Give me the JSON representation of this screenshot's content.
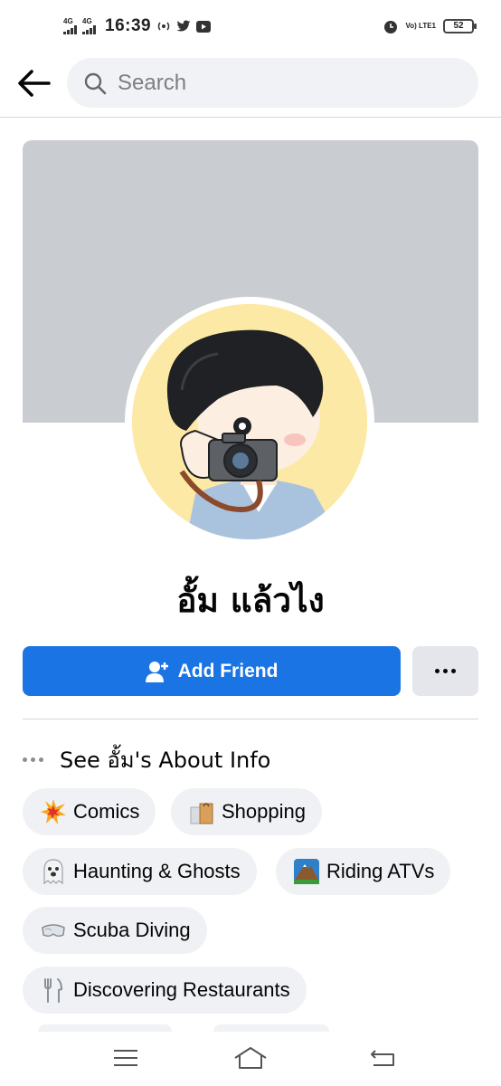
{
  "status_bar": {
    "time": "16:39",
    "network1": "4G",
    "network2": "4G",
    "volte": "Vo) LTE1",
    "battery": "52"
  },
  "search": {
    "placeholder": "Search"
  },
  "profile": {
    "name": "อั้ม แล้วไง"
  },
  "actions": {
    "add_friend_label": "Add Friend"
  },
  "about": {
    "label": "See อั้ม's About Info"
  },
  "interests": [
    {
      "label": "Comics",
      "icon": "collision-emoji"
    },
    {
      "label": "Shopping",
      "icon": "shopping-bags-emoji"
    },
    {
      "label": "Haunting & Ghosts",
      "icon": "ghost-emoji"
    },
    {
      "label": "Riding ATVs",
      "icon": "mountain-emoji"
    },
    {
      "label": "Scuba Diving",
      "icon": "goggles-emoji"
    },
    {
      "label": "Discovering Restaurants",
      "icon": "fork-knife-emoji"
    }
  ],
  "colors": {
    "primary": "#1b74e4",
    "chip_bg": "#eff1f4",
    "cover": "#c9ccd1"
  }
}
